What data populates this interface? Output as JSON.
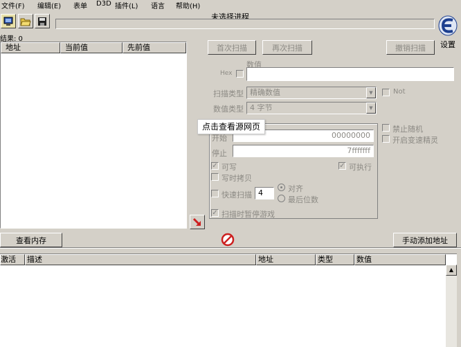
{
  "menu": [
    "文件(F)",
    "编辑(E)",
    "表单",
    "D3D",
    "插件(L)",
    "语言",
    "帮助(H)"
  ],
  "title": "未选择进程",
  "settings_label": "设置",
  "results_label": "结果: 0",
  "scan_list": {
    "columns": [
      "地址",
      "当前值",
      "先前值"
    ]
  },
  "buttons": {
    "first_scan": "首次扫描",
    "next_scan": "再次扫描",
    "undo_scan": "撤销扫描",
    "view_memory": "查看内存",
    "add_address": "手动添加地址"
  },
  "value_label": "数值",
  "hex_label": "Hex",
  "scan_type": {
    "label": "扫描类型",
    "value": "精确数值"
  },
  "value_type": {
    "label": "数值类型",
    "value": "4 字节"
  },
  "not_label": "Not",
  "tooltip": "点击查看源网页",
  "memory_options": {
    "start_label": "开始",
    "start_value": "00000000",
    "stop_label": "停止",
    "stop_value": "7fffffff",
    "writable": "可写",
    "executable": "可执行",
    "copy_on_write": "写时拷贝",
    "fast_scan": "快速扫描",
    "fast_scan_value": "4",
    "align": "对齐",
    "last_digits": "最后位数",
    "pause_game": "扫描时暂停游戏"
  },
  "side_options": {
    "disable_random": "禁止随机",
    "speedhack": "开启变速精灵"
  },
  "address_table": {
    "columns": [
      "激活",
      "描述",
      "地址",
      "类型",
      "数值"
    ]
  },
  "colors": {
    "window_bg": "#d4d0c8",
    "logo_blue": "#1d3f8f",
    "stop_red": "#cc1f1f"
  }
}
